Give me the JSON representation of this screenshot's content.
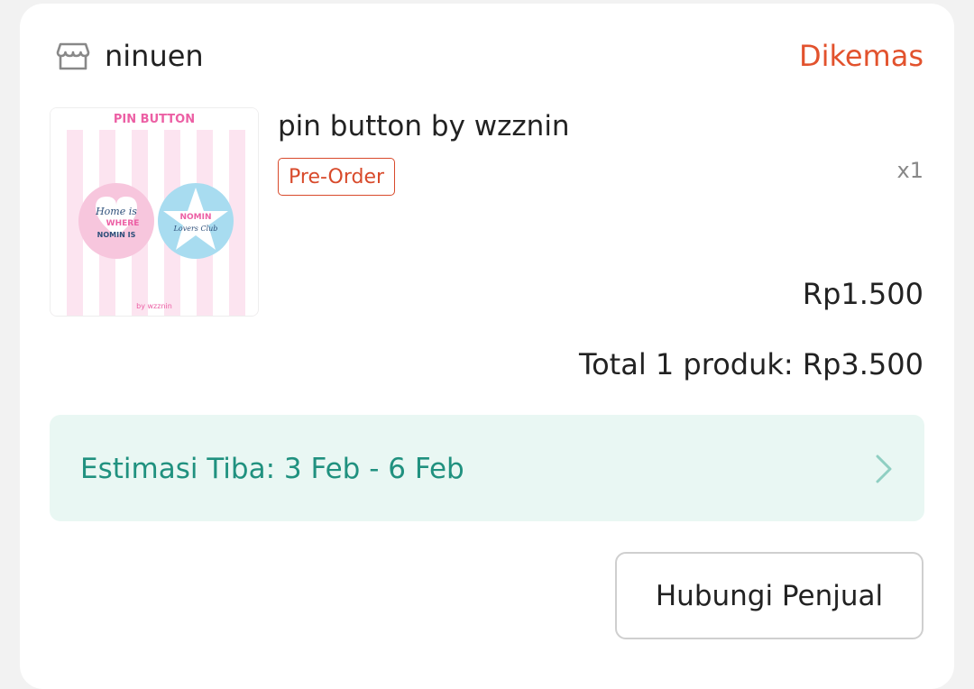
{
  "shop": {
    "name": "ninuen",
    "status": "Dikemas"
  },
  "product": {
    "title": "pin button by wzznin",
    "badge": "Pre-Order",
    "quantity": "x1",
    "price": "Rp1.500",
    "image": {
      "header": "PIN BUTTON",
      "left_text_1": "Home is",
      "left_text_2": "WHERE",
      "left_text_3": "NOMIN IS",
      "right_text_1": "NOMIN",
      "right_text_2": "Lovers Club",
      "footer": "by wzznin"
    }
  },
  "order": {
    "total": "Total 1 produk: Rp3.500"
  },
  "delivery": {
    "estimate": "Estimasi Tiba: 3 Feb - 6 Feb"
  },
  "actions": {
    "contact_label": "Hubungi Penjual"
  },
  "colors": {
    "status": "#e2522d",
    "estimate_text": "#20917f",
    "estimate_bg": "#e9f7f3"
  }
}
